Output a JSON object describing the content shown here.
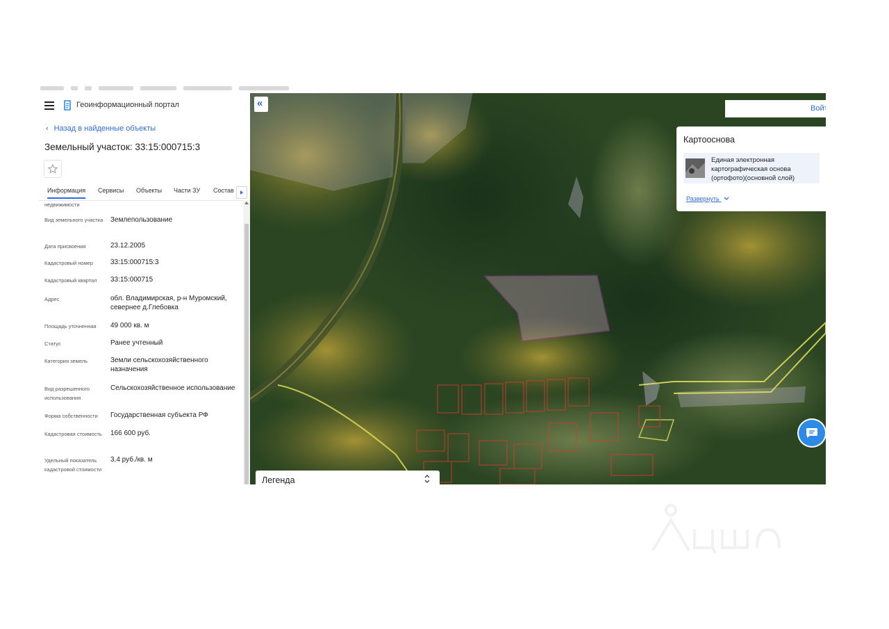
{
  "header": {
    "portal_title": "Геоинформационный портал"
  },
  "panel": {
    "back_link": "Назад в найденные объекты",
    "object_title": "Земельный участок: 33:15:000715:3",
    "tabs": [
      {
        "label": "Информация",
        "active": true
      },
      {
        "label": "Сервисы",
        "active": false
      },
      {
        "label": "Объекты",
        "active": false
      },
      {
        "label": "Части ЗУ",
        "active": false
      },
      {
        "label": "Состав",
        "active": false
      }
    ],
    "attributes": [
      {
        "label": "недвижимости",
        "value": ""
      },
      {
        "label": "Вид земельного участка",
        "value": "Землепользование"
      },
      {
        "label": "Дата присвоения",
        "value": "23.12.2005"
      },
      {
        "label": "Кадастровый номер",
        "value": "33:15:000715:3"
      },
      {
        "label": "Кадастровый квартал",
        "value": "33:15:000715"
      },
      {
        "label": "Адрес",
        "value": "обл. Владимирская, р-н Муромский, севернее д.Глебовка"
      },
      {
        "label": "Площадь уточненная",
        "value": "49 000 кв. м"
      },
      {
        "label": "Статус",
        "value": "Ранее учтенный"
      },
      {
        "label": "Категория земель",
        "value": "Земли сельскохозяйственного назначения"
      },
      {
        "label": "Вид разрешенного использования",
        "value": "Сельскохозяйственное использование"
      },
      {
        "label": "Форма собственности",
        "value": "Государственная субъекта РФ"
      },
      {
        "label": "Кадастровая стоимость",
        "value": "166 600 руб."
      },
      {
        "label": "Удельный показатель кадастровой стоимости",
        "value": "3,4 руб./кв. м"
      }
    ]
  },
  "map": {
    "login_label": "Войт",
    "basemap": {
      "title": "Картооснова",
      "layer_label": "Единая электронная картографическая основа (ортофото)(основной слой)",
      "expand_label": "Развернуть"
    },
    "legend_label": "Легенда"
  },
  "colors": {
    "accent": "#2d6cdf",
    "parcel_outline": "#c026d3",
    "boundary_yellow": "#e6e35a",
    "boundary_red": "#d63b2f",
    "chat": "#2d8ae6"
  },
  "icons": [
    "hamburger-icon",
    "portal-logo-icon",
    "chevron-left-icon",
    "star-icon",
    "chevron-right-icon",
    "double-chevron-left-icon",
    "chevron-down-icon",
    "chat-icon",
    "sort-arrows-icon"
  ]
}
